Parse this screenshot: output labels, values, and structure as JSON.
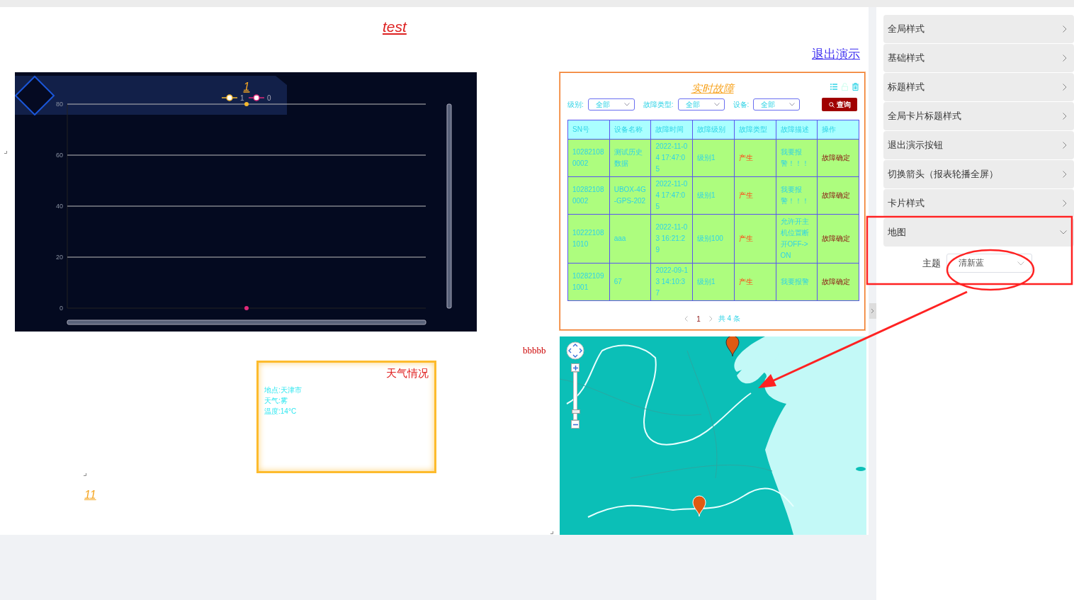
{
  "page_title": "test",
  "exit_link": "退出演示",
  "chart_widget": {
    "chart_data": {
      "type": "line",
      "title": "1",
      "categories": [
        null
      ],
      "yticks": [
        0,
        20,
        40,
        60,
        80
      ],
      "ylim": [
        0,
        80
      ],
      "grid": true,
      "legend": "top",
      "series": [
        {
          "name": "1",
          "color": "#f5b82e",
          "marker": "circle",
          "values": [
            80
          ]
        },
        {
          "name": "0",
          "color": "#e0297a",
          "marker": "circle",
          "values": [
            0
          ]
        }
      ]
    }
  },
  "fault_card": {
    "title": "实时故障",
    "filters": [
      {
        "label": "级别:",
        "value": "全部"
      },
      {
        "label": "故障类型:",
        "value": "全部"
      },
      {
        "label": "设备:",
        "value": "全部"
      }
    ],
    "search_button": "查询",
    "table": {
      "columns": [
        "SN号",
        "设备名称",
        "故障时间",
        "故障级别",
        "故障类型",
        "故障描述",
        "操作"
      ],
      "rows": [
        [
          "102821080002",
          "测试历史数据",
          "2022-11-04 17:47:05",
          "级别1",
          "产生",
          "我要报警！！！",
          "故障确定"
        ],
        [
          "102821080002",
          "UBOX-4G-GPS-202",
          "2022-11-04 17:47:05",
          "级别1",
          "产生",
          "我要报警！！！",
          "故障确定"
        ],
        [
          "102221081010",
          "aaa",
          "2022-11-03 16:21:29",
          "级别100",
          "产生",
          "允许开主机位置断开OFF->ON",
          "故障确定"
        ],
        [
          "102821091001",
          "67",
          "2022-09-13 14:10:37",
          "级别1",
          "产生",
          "我要报警",
          "故障确定"
        ]
      ]
    },
    "pagination": {
      "pages": [
        {
          "label": "1",
          "selected": true
        }
      ],
      "total": "共 4 条"
    }
  },
  "label_text": "bbbbb",
  "weather_card": {
    "title": "天气情况",
    "lines": [
      "地点:天津市",
      "天气:雾",
      "温度:14°C"
    ]
  },
  "number_label": "11",
  "map": {
    "kind": "picture",
    "zoom_slider": {
      "level": 0.2
    }
  },
  "settings_panel": {
    "sections": [
      {
        "label": "全局样式",
        "expanded": false
      },
      {
        "label": "基础样式",
        "expanded": false
      },
      {
        "label": "标题样式",
        "expanded": false
      },
      {
        "label": "全局卡片标题样式",
        "expanded": false
      },
      {
        "label": "退出演示按钮",
        "expanded": false
      },
      {
        "label": "切换箭头（报表轮播全屏）",
        "expanded": false
      },
      {
        "label": "卡片样式",
        "expanded": false
      },
      {
        "label": "地图",
        "expanded": true,
        "fields": [
          {
            "label": "主题",
            "value": "清新蓝"
          }
        ]
      }
    ]
  }
}
